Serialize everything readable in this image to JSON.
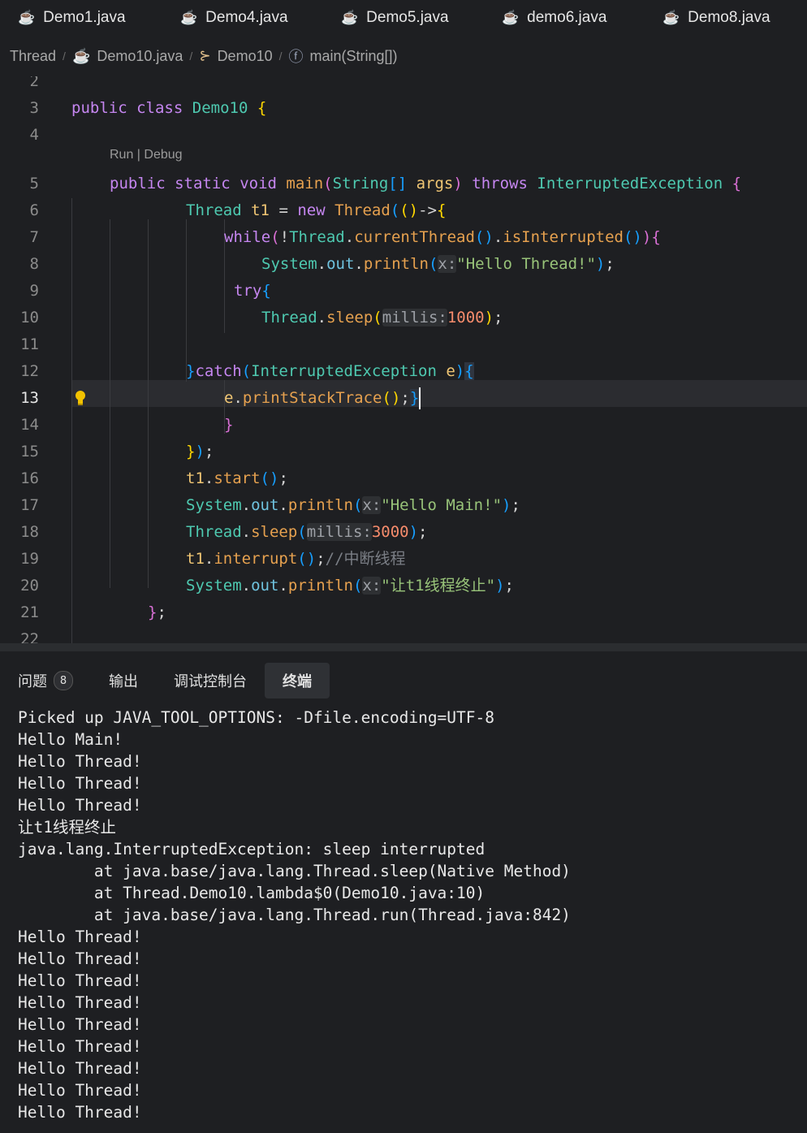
{
  "tabs": [
    {
      "label": "Demo1.java"
    },
    {
      "label": "Demo4.java"
    },
    {
      "label": "Demo5.java"
    },
    {
      "label": "demo6.java"
    },
    {
      "label": "Demo8.java"
    }
  ],
  "breadcrumb": {
    "folder": "Thread",
    "file": "Demo10.java",
    "class": "Demo10",
    "method": "main(String[])"
  },
  "editor": {
    "line_numbers": [
      "2",
      "3",
      "4",
      "5",
      "6",
      "7",
      "8",
      "9",
      "10",
      "11",
      "12",
      "13",
      "14",
      "15",
      "16",
      "17",
      "18",
      "19",
      "20",
      "21",
      "22"
    ],
    "current_line": "13",
    "codelens": "Run | Debug",
    "hint_x": "x:",
    "hint_millis": "millis:",
    "str_hello_thread": "\"Hello Thread!\"",
    "str_hello_main": "\"Hello Main!\"",
    "str_stop": "\"让t1线程终止\"",
    "num_1000": "1000",
    "num_3000": "3000",
    "comment": "//中断线程"
  },
  "panel": {
    "tabs": [
      {
        "label": "问题",
        "badge": "8"
      },
      {
        "label": "输出"
      },
      {
        "label": "调试控制台"
      },
      {
        "label": "终端"
      }
    ],
    "active_tab": "终端"
  },
  "terminal": {
    "lines": [
      "Picked up JAVA_TOOL_OPTIONS: -Dfile.encoding=UTF-8",
      "Hello Main!",
      "Hello Thread!",
      "Hello Thread!",
      "Hello Thread!",
      "让t1线程终止",
      "java.lang.InterruptedException: sleep interrupted",
      "        at java.base/java.lang.Thread.sleep(Native Method)",
      "        at Thread.Demo10.lambda$0(Demo10.java:10)",
      "        at java.base/java.lang.Thread.run(Thread.java:842)",
      "Hello Thread!",
      "Hello Thread!",
      "Hello Thread!",
      "Hello Thread!",
      "Hello Thread!",
      "Hello Thread!",
      "Hello Thread!",
      "Hello Thread!",
      "Hello Thread!"
    ]
  }
}
